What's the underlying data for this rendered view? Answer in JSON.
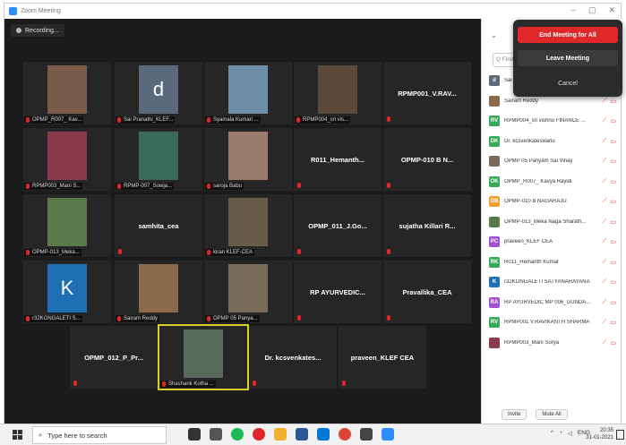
{
  "window": {
    "title": "Zoom Meeting"
  },
  "recording": {
    "label": "Recording..."
  },
  "tiles": [
    {
      "label": "OPMP_R007_ Kav...",
      "name": "",
      "type": "photo",
      "color": "#7a5a48"
    },
    {
      "label": "Sai Pranathi_KLEF...",
      "name": "",
      "type": "letter",
      "letter": "d",
      "color": "#5a6a7a"
    },
    {
      "label": "Syamala Kumari ...",
      "name": "",
      "type": "photo",
      "color": "#6d8fa8"
    },
    {
      "label": "RPMP004_sri vis...",
      "name": "",
      "type": "photo",
      "color": "#5b4a3a"
    },
    {
      "label": "",
      "name": "RPMP001_V.RAV...",
      "type": "name"
    },
    {
      "label": "RPMP003_Mani S...",
      "name": "",
      "type": "photo",
      "color": "#8a3a4a"
    },
    {
      "label": "RPMP-007_Sowja...",
      "name": "",
      "type": "photo",
      "color": "#3a6a5a"
    },
    {
      "label": "saroja Babu",
      "name": "",
      "type": "photo",
      "color": "#9a7a6a"
    },
    {
      "label": "",
      "name": "R011_Hemanth...",
      "type": "name"
    },
    {
      "label": "",
      "name": "OPMP-010 B N...",
      "type": "name"
    },
    {
      "label": "OPMP-013_Meka...",
      "name": "",
      "type": "photo",
      "color": "#5a7a4a"
    },
    {
      "label": "",
      "name": "samhita_cea",
      "type": "name"
    },
    {
      "label": "kiran KLEF-CEA",
      "name": "",
      "type": "photo",
      "color": "#6a5a4a"
    },
    {
      "label": "",
      "name": "OPMP_011_J.Go...",
      "type": "name"
    },
    {
      "label": "",
      "name": "sujatha Killari R...",
      "type": "name"
    },
    {
      "label": "r32KONGALETI S...",
      "name": "",
      "type": "letter",
      "letter": "K",
      "color": "#1f6fb5"
    },
    {
      "label": "Sairam Reddy",
      "name": "",
      "type": "photo",
      "color": "#8a6a4a"
    },
    {
      "label": "OPMP 05 Panya...",
      "name": "",
      "type": "photo",
      "color": "#7a6a5a"
    },
    {
      "label": "",
      "name": "RP AYURVEDIC...",
      "type": "name"
    },
    {
      "label": "",
      "name": "Pravallika_CEA",
      "type": "name"
    },
    {
      "label": "",
      "name": "OPMP_012_P_Pr...",
      "type": "name"
    },
    {
      "label": "Shashank Kotha ...",
      "name": "",
      "type": "photo",
      "color": "#5a6a5a"
    },
    {
      "label": "",
      "name": "Dr. kcsvenkates...",
      "type": "name"
    },
    {
      "label": "",
      "name": "praveen_KLEF CEA",
      "type": "name"
    }
  ],
  "popup": {
    "end": "End Meeting for All",
    "leave": "Leave Meeting",
    "cancel": "Cancel"
  },
  "panel": {
    "find_placeholder": "Q Find",
    "invite": "Invite",
    "mute_all": "Mute All"
  },
  "participants": [
    {
      "initials": "d",
      "name": "Sai Pranathi_KLEF",
      "color": "#5a6a7a"
    },
    {
      "initials": "",
      "name": "Sairam Reddy",
      "color": "#8a6a4a"
    },
    {
      "initials": "RV",
      "name": "RPMP004_sri vishnu FINANCE ...",
      "color": "#3aa85a"
    },
    {
      "initials": "DK",
      "name": "Dr. kcsvenkateswarlu",
      "color": "#3aa85a"
    },
    {
      "initials": "",
      "name": "OPMP 05 Panyam Sai Vinay",
      "color": "#7a6a5a"
    },
    {
      "initials": "OK",
      "name": "OPMP_R007_ Kavya Rayidi",
      "color": "#3aa85a"
    },
    {
      "initials": "OB",
      "name": "OPMP-010 B NAGARAJU",
      "color": "#f0a030"
    },
    {
      "initials": "",
      "name": "OPMP-013_Meka Naga Sharath...",
      "color": "#5a7a4a"
    },
    {
      "initials": "PC",
      "name": "praveen_KLEF CEA",
      "color": "#a050d0"
    },
    {
      "initials": "RK",
      "name": "R011_Hemanth Kumar",
      "color": "#3aa85a"
    },
    {
      "initials": "K",
      "name": "r32KONGALETI SATYANARAYANA",
      "color": "#1f6fb5"
    },
    {
      "initials": "RA",
      "name": "RP AYURVEDIC MP 006_GUNDA...",
      "color": "#a050d0"
    },
    {
      "initials": "RV",
      "name": "RPMP001 V.RAVIKANTH SHARMA",
      "color": "#3aa85a"
    },
    {
      "initials": "",
      "name": "RPMP003_Mani Surya",
      "color": "#8a3a4a"
    }
  ],
  "taskbar": {
    "search": "Type here to search",
    "lang": "ENG",
    "time": "20:35",
    "date": "31-01-2021"
  }
}
